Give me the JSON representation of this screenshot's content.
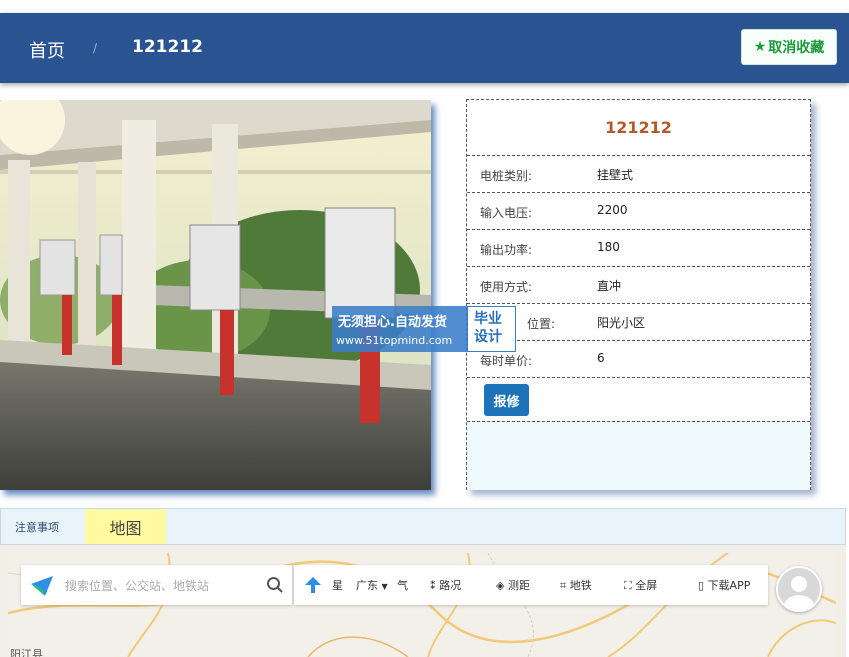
{
  "header": {
    "breadcrumb_home": "首页",
    "breadcrumb_sep": "/",
    "breadcrumb_current": "121212",
    "favorite_button": "取消收藏"
  },
  "detail": {
    "title": "121212",
    "rows": [
      {
        "label": "电桩类别:",
        "value": "挂壁式"
      },
      {
        "label": "输入电压:",
        "value": "2200"
      },
      {
        "label": "输出功率:",
        "value": "180"
      },
      {
        "label": "使用方式:",
        "value": "直冲"
      },
      {
        "label": "位置:",
        "value": "阳光小区"
      },
      {
        "label": "每时单价:",
        "value": "6"
      }
    ],
    "repair_button": "报修"
  },
  "watermark": {
    "line1": "无须担心.自动发货",
    "line2": "www.51topmind.com",
    "badge_line1": "毕业",
    "badge_line2": "设计"
  },
  "tabs": {
    "notice": "注意事项",
    "map": "地图"
  },
  "map": {
    "search_placeholder": "搜索位置、公交站、地铁站",
    "tools": {
      "star": "星",
      "region": "广东",
      "weather": "气",
      "traffic": "路况",
      "measure": "测距",
      "subway": "地铁",
      "fullscreen": "全屏",
      "download": "下载APP"
    },
    "place_label": "阳江县"
  },
  "colors": {
    "header": "#2a5391",
    "favorite_text": "#1e9a3c",
    "title": "#b35a2a",
    "repair_button": "#1c73b8",
    "map_tab_bg": "#fff9a0"
  }
}
